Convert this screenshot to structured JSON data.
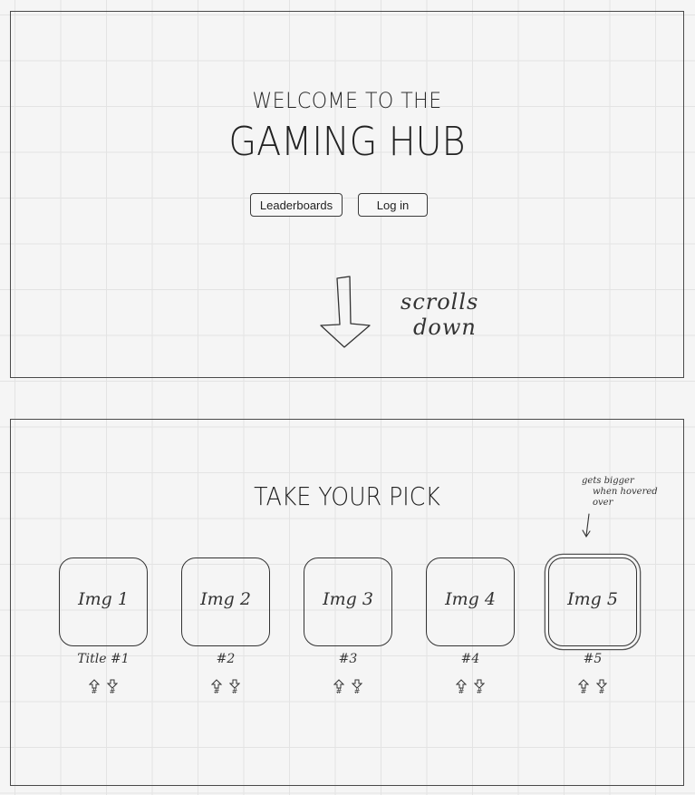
{
  "hero": {
    "welcome_line": "WELCOME TO THE",
    "title": "GAMING HUB",
    "buttons": {
      "leaderboards": "Leaderboards",
      "login": "Log in"
    },
    "scroll_annotation": [
      "scrolls",
      "down"
    ],
    "scroll_icon": "arrow-down-icon"
  },
  "picker": {
    "title": "TAKE YOUR PICK",
    "hover_annotation": [
      "gets bigger",
      "when hovered",
      "over"
    ],
    "cards": [
      {
        "image_label": "Img 1",
        "title": "Title #1",
        "hovered": false
      },
      {
        "image_label": "Img 2",
        "title": "#2",
        "hovered": false
      },
      {
        "image_label": "Img 3",
        "title": "#3",
        "hovered": false
      },
      {
        "image_label": "Img 4",
        "title": "#4",
        "hovered": false
      },
      {
        "image_label": "Img 5",
        "title": "#5",
        "hovered": true
      }
    ],
    "vote_icons": {
      "up": "up-arrow-icon",
      "down": "down-arrow-icon"
    },
    "vote_count_symbol": "#"
  },
  "colors": {
    "background": "#f5f5f5",
    "grid": "#e3e3e3",
    "stroke": "#333333"
  }
}
